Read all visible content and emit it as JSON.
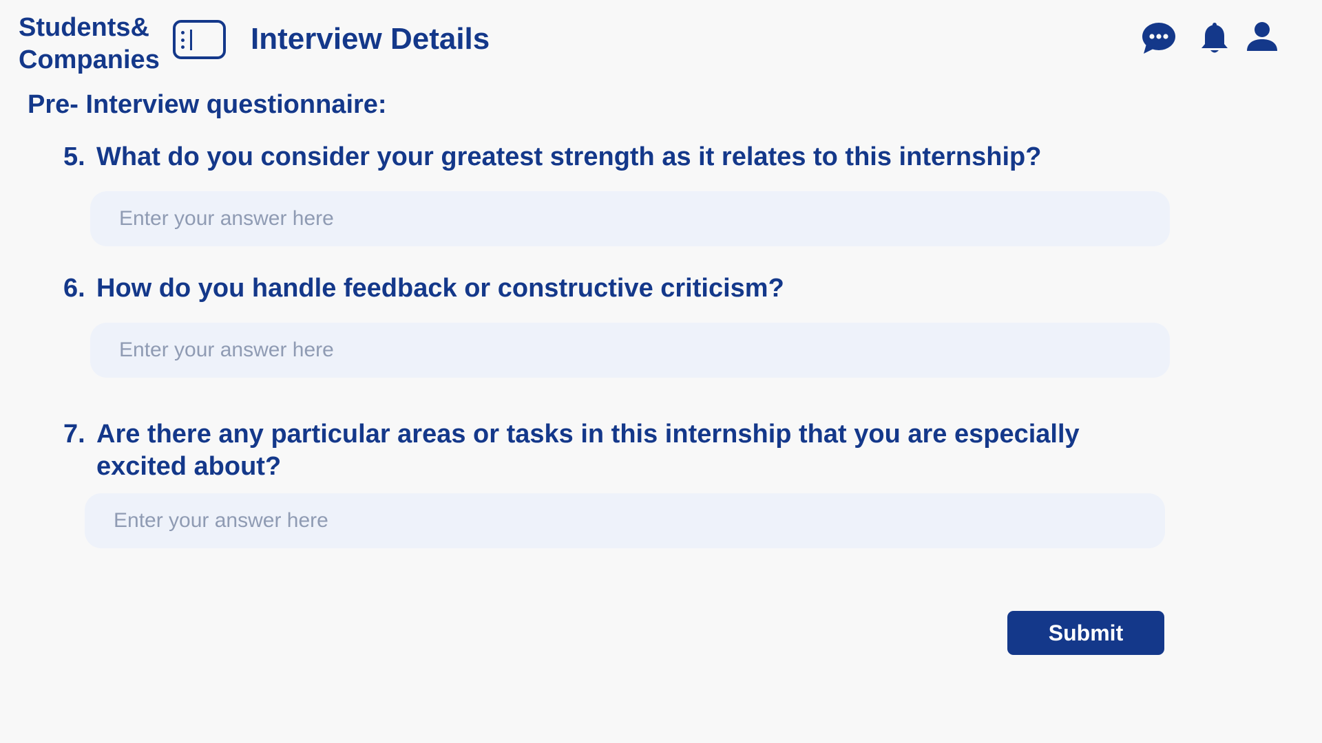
{
  "app": {
    "logo_line1": "Students&",
    "logo_line2": "Companies"
  },
  "header": {
    "title": "Interview Details",
    "icons": [
      "chat-bubble-icon",
      "bell-icon",
      "user-icon"
    ]
  },
  "colors": {
    "primary": "#14388a",
    "input_background": "#eef2fa",
    "placeholder": "#8f9bb3",
    "page_background": "#f8f8f8"
  },
  "questionnaire": {
    "title": "Pre- Interview questionnaire:",
    "questions": [
      {
        "number": "5.",
        "text": "What do you consider your greatest strength as it relates to this internship?",
        "placeholder": "Enter your answer here",
        "value": ""
      },
      {
        "number": "6.",
        "text": "How do you handle feedback or constructive criticism?",
        "placeholder": "Enter your answer here",
        "value": ""
      },
      {
        "number": "7.",
        "text": "Are there any particular areas or tasks in this internship that you are especially excited about?",
        "placeholder": "Enter your answer here",
        "value": ""
      }
    ],
    "submit_label": "Submit"
  }
}
